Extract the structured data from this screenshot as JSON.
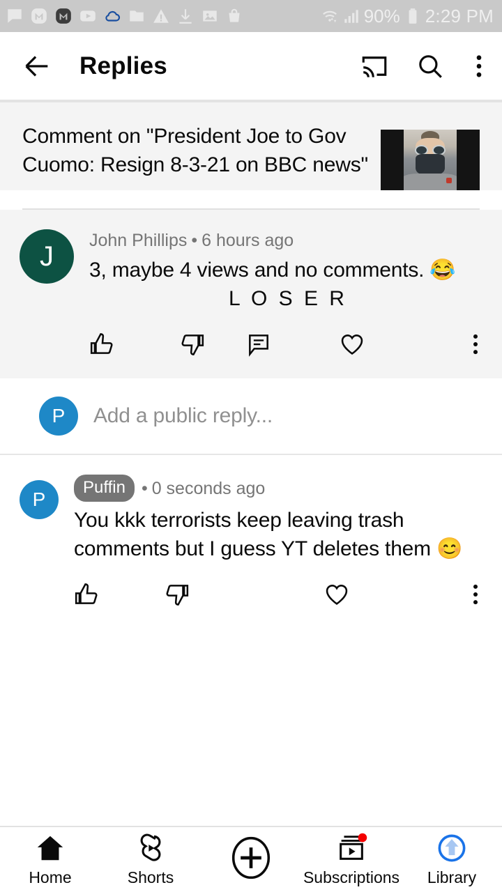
{
  "status_bar": {
    "icons": [
      "message-bubble-icon",
      "messenger-m-icon",
      "messenger-m-dark-icon",
      "youtube-play-icon",
      "cloud-icon",
      "folder-icon",
      "warning-triangle-icon",
      "download-icon",
      "photo-icon",
      "shopping-bag-icon"
    ],
    "wifi_icon": "wifi-data-icon",
    "signal_icon": "signal-bars-icon",
    "battery_percent": "90%",
    "battery_icon": "battery-icon",
    "time": "2:29 PM",
    "background_color": "#c9c9c9",
    "foreground_color": "#efefef"
  },
  "app_bar": {
    "back_icon": "back-arrow-icon",
    "title": "Replies",
    "cast_icon": "cast-icon",
    "search_icon": "search-icon",
    "overflow_icon": "kebab-menu-icon"
  },
  "video_header": {
    "title": "Comment on \"President Joe to Gov Cuomo: Resign 8-3-21 on BBC news\"",
    "thumbnail_alt": "video-thumbnail"
  },
  "comments": [
    {
      "avatar_letter": "J",
      "avatar_color": "#0d5243",
      "author": "John Phillips",
      "separator": "•",
      "timestamp": "6 hours ago",
      "text": "3, maybe 4 views and no comments. 😂",
      "text_second_line": "L O S E R",
      "highlighted": true,
      "actions": [
        "like-icon",
        "dislike-icon",
        "reply-icon",
        "heart-icon",
        "kebab-menu-icon"
      ]
    },
    {
      "avatar_letter": "P",
      "avatar_color": "#1e88c7",
      "badge": "Puffin",
      "separator": "•",
      "timestamp": "0 seconds ago",
      "text": "You kkk terrorists keep leaving trash comments but I guess YT deletes them 😊",
      "highlighted": false,
      "actions": [
        "like-icon",
        "dislike-icon",
        "heart-icon",
        "kebab-menu-icon"
      ]
    }
  ],
  "composer": {
    "avatar_letter": "P",
    "avatar_color": "#1e88c7",
    "placeholder": "Add a public reply..."
  },
  "bottom_nav": {
    "items": [
      {
        "label": "Home",
        "icon": "home-icon",
        "badge": false
      },
      {
        "label": "Shorts",
        "icon": "shorts-icon",
        "badge": false
      },
      {
        "label": "",
        "icon": "create-plus-icon",
        "badge": false
      },
      {
        "label": "Subscriptions",
        "icon": "subscriptions-icon",
        "badge": true
      },
      {
        "label": "Library",
        "icon": "library-upload-icon",
        "badge": false
      }
    ],
    "badge_color": "#f40000",
    "library_color": "#1a73e8"
  }
}
